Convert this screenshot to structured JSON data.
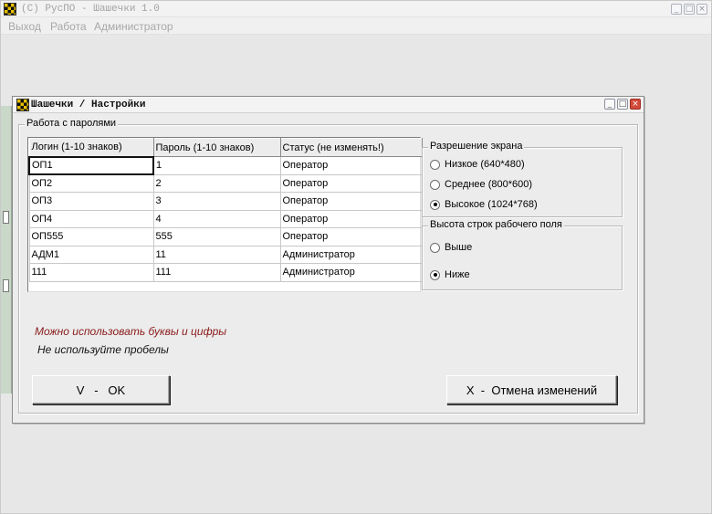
{
  "app": {
    "title": "(C) РусПО - Шашечки 1.0",
    "window_buttons": [
      "_",
      "□",
      "×"
    ]
  },
  "menu": {
    "items": [
      "Выход",
      "Работа",
      "Администратор"
    ]
  },
  "dialog": {
    "title": "Шашечки / Настройки",
    "window_buttons": [
      "_",
      "□",
      "×"
    ],
    "passwords_group": {
      "label": "Работа с паролями",
      "columns": [
        "Логин (1-10 знаков)",
        "Пароль (1-10 знаков)",
        "Статус (не изменять!)"
      ],
      "rows": [
        [
          "ОП1",
          "1",
          "Оператор"
        ],
        [
          "ОП2",
          "2",
          "Оператор"
        ],
        [
          "ОП3",
          "3",
          "Оператор"
        ],
        [
          "ОП4",
          "4",
          "Оператор"
        ],
        [
          "ОП555",
          "555",
          "Оператор"
        ],
        [
          "АДМ1",
          "11",
          "Администратор"
        ],
        [
          "111",
          "111",
          "Администратор"
        ]
      ]
    },
    "resolution_group": {
      "label": "Разрешение экрана",
      "options": [
        {
          "label": "Низкое (640*480)",
          "checked": false
        },
        {
          "label": "Среднее (800*600)",
          "checked": false
        },
        {
          "label": "Высокое (1024*768)",
          "checked": true
        }
      ]
    },
    "row_height_group": {
      "label": "Высота строк рабочего поля",
      "options": [
        {
          "label": "Выше",
          "checked": false
        },
        {
          "label": "Ниже",
          "checked": true
        }
      ]
    },
    "notes": {
      "hint1": "Можно использовать буквы и цифры",
      "hint2": "Не используйте пробелы"
    },
    "buttons": {
      "ok": "V   -   OK",
      "cancel": "X  -  Отмена изменений"
    }
  },
  "colors": {
    "hint1": "#8a1a1a",
    "window_bg": "#e7e7e7",
    "dialog_bg": "#ececec"
  }
}
